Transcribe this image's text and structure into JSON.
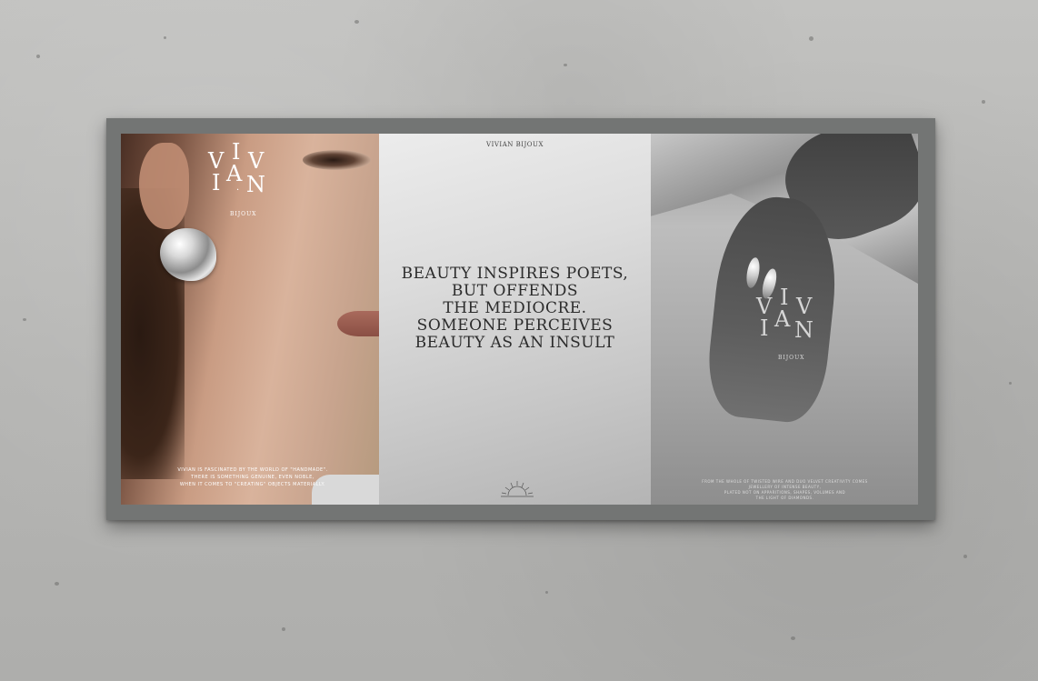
{
  "left_panel": {
    "logo_letters": [
      "V",
      "I",
      "V",
      "I",
      "A",
      "N"
    ],
    "logo_dot": "·",
    "logo_sub": "BIJOUX",
    "caption_lines": [
      "Vivian is fascinated by the world of \"handmade\".",
      "There is something genuine, even noble,",
      "when it comes to \"creating\" objects materially."
    ]
  },
  "middle_panel": {
    "brand": "VIVIAN BIJOUX",
    "quote_lines": [
      "BEAUTY INSPIRES POETS,",
      "BUT OFFENDS",
      "THE MEDIOCRE.",
      "SOMEONE PERCEIVES",
      "BEAUTY AS AN INSULT"
    ]
  },
  "right_panel": {
    "logo_letters": [
      "V",
      "I",
      "V",
      "I",
      "A",
      "N"
    ],
    "logo_sub": "BIJOUX",
    "caption_lines": [
      "From the whole of twisted wire and Duo velvet creativity comes",
      "jewellery of intense beauty,",
      "plated not on apparitions, shapes, volumes and",
      "the light of diamonds."
    ]
  },
  "colors": {
    "frame": "#737574",
    "wall": "#b9b9b7",
    "quote_text": "#2b2b2b"
  }
}
